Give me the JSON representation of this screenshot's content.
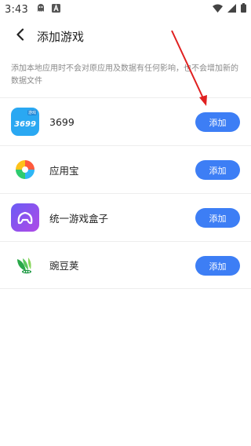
{
  "status_bar": {
    "time": "3:43",
    "icons": [
      "ghost-icon",
      "a-badge-icon",
      "wifi-icon",
      "signal-icon",
      "battery-icon"
    ]
  },
  "header": {
    "title": "添加游戏",
    "back_icon": "chevron-left-icon"
  },
  "notice": "添加本地应用时不会对原应用及数据有任何影响，也不会增加新的数据文件",
  "games": [
    {
      "name": "3699",
      "button": "添加",
      "icon": "app-3699-icon",
      "icon_text": "3699",
      "icon_badge": "游戏"
    },
    {
      "name": "应用宝",
      "button": "添加",
      "icon": "yingyongbao-icon"
    },
    {
      "name": "统一游戏盒子",
      "button": "添加",
      "icon": "game-box-icon"
    },
    {
      "name": "豌豆荚",
      "button": "添加",
      "icon": "wandoujia-icon"
    }
  ],
  "colors": {
    "accent": "#3d7ef5",
    "annotation": "#e02020",
    "app3699_bg": "#2aa8f2",
    "gamebox_bg": "#8a4cf0"
  }
}
